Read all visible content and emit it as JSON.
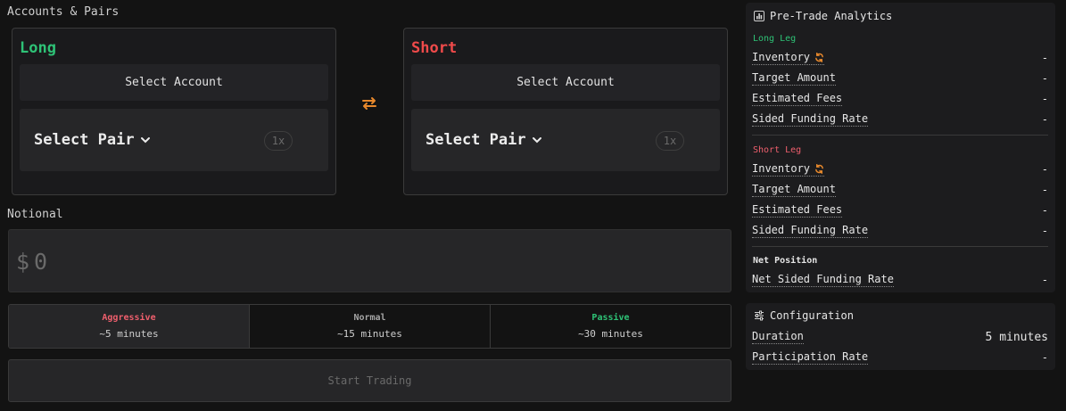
{
  "header": {
    "title": "Accounts & Pairs"
  },
  "legs": {
    "long": {
      "title": "Long",
      "select_account": "Select Account",
      "select_pair": "Select Pair",
      "leverage": "1x",
      "color": "#2ec276"
    },
    "short": {
      "title": "Short",
      "select_account": "Select Account",
      "select_pair": "Select Pair",
      "leverage": "1x",
      "color": "#ef4a4a"
    }
  },
  "notional": {
    "label": "Notional",
    "currency": "$",
    "placeholder": "0"
  },
  "speed": {
    "options": [
      {
        "name": "Aggressive",
        "time": "~5 minutes",
        "active": true,
        "color": "#ef5f6d"
      },
      {
        "name": "Normal",
        "time": "~15 minutes",
        "active": false,
        "color": "#a5a5a5"
      },
      {
        "name": "Passive",
        "time": "~30 minutes",
        "active": false,
        "color": "#2ec276"
      }
    ]
  },
  "start_button": "Start Trading",
  "analytics": {
    "title": "Pre-Trade Analytics",
    "long_leg": {
      "label": "Long Leg",
      "rows": [
        {
          "label": "Inventory",
          "value": "-"
        },
        {
          "label": "Target Amount",
          "value": "-"
        },
        {
          "label": "Estimated Fees",
          "value": "-"
        },
        {
          "label": "Sided Funding Rate",
          "value": "-"
        }
      ]
    },
    "short_leg": {
      "label": "Short Leg",
      "rows": [
        {
          "label": "Inventory",
          "value": "-"
        },
        {
          "label": "Target Amount",
          "value": "-"
        },
        {
          "label": "Estimated Fees",
          "value": "-"
        },
        {
          "label": "Sided Funding Rate",
          "value": "-"
        }
      ]
    },
    "net_position": {
      "label": "Net Position",
      "rows": [
        {
          "label": "Net Sided Funding Rate",
          "value": "-"
        }
      ]
    }
  },
  "configuration": {
    "title": "Configuration",
    "rows": [
      {
        "label": "Duration",
        "value": "5 minutes"
      },
      {
        "label": "Participation Rate",
        "value": "-"
      }
    ]
  },
  "colors": {
    "accent_orange": "#e8892c",
    "green": "#2ec276",
    "red": "#ef4a4a",
    "background": "#131313"
  },
  "icons": [
    "swap-arrows-icon",
    "chevron-down-icon",
    "refresh-icon",
    "bar-chart-icon",
    "sliders-icon"
  ]
}
